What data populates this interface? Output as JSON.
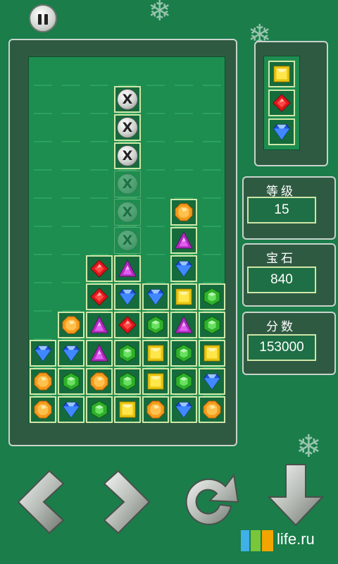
{
  "stats": {
    "level": {
      "label": "等级",
      "value": "15"
    },
    "gems": {
      "label": "宝石",
      "value": "840"
    },
    "score": {
      "label": "分数",
      "value": "153000"
    }
  },
  "watermark": {
    "text": "life.ru"
  },
  "icons": {
    "pause": "pause-icon",
    "left": "arrow-left-icon",
    "right": "arrow-right-icon",
    "rotate": "rotate-icon",
    "drop": "arrow-down-icon",
    "snowflake": "snowflake-icon"
  },
  "colors": {
    "background": "#1a7d4a",
    "board": "#1e8d50",
    "frame": "#2f5a42",
    "cell_border": "#cfe7a8"
  },
  "board": {
    "columns": 7,
    "rows": 13,
    "falling_piece": [
      "x",
      "x",
      "x"
    ],
    "cells": [
      {
        "r": 5,
        "c": 5,
        "g": "orange"
      },
      {
        "r": 6,
        "c": 5,
        "g": "purple"
      },
      {
        "r": 7,
        "c": 2,
        "g": "red"
      },
      {
        "r": 7,
        "c": 3,
        "g": "purple"
      },
      {
        "r": 7,
        "c": 5,
        "g": "blue"
      },
      {
        "r": 8,
        "c": 2,
        "g": "red"
      },
      {
        "r": 8,
        "c": 3,
        "g": "blue"
      },
      {
        "r": 8,
        "c": 4,
        "g": "blue"
      },
      {
        "r": 8,
        "c": 5,
        "g": "yellow"
      },
      {
        "r": 8,
        "c": 6,
        "g": "green"
      },
      {
        "r": 9,
        "c": 1,
        "g": "orange"
      },
      {
        "r": 9,
        "c": 2,
        "g": "purple"
      },
      {
        "r": 9,
        "c": 3,
        "g": "red"
      },
      {
        "r": 9,
        "c": 4,
        "g": "green"
      },
      {
        "r": 9,
        "c": 5,
        "g": "purple"
      },
      {
        "r": 9,
        "c": 6,
        "g": "green"
      },
      {
        "r": 10,
        "c": 0,
        "g": "blue"
      },
      {
        "r": 10,
        "c": 1,
        "g": "blue"
      },
      {
        "r": 10,
        "c": 2,
        "g": "purple"
      },
      {
        "r": 10,
        "c": 3,
        "g": "green"
      },
      {
        "r": 10,
        "c": 4,
        "g": "yellow"
      },
      {
        "r": 10,
        "c": 5,
        "g": "green"
      },
      {
        "r": 10,
        "c": 6,
        "g": "yellow"
      },
      {
        "r": 11,
        "c": 0,
        "g": "orange"
      },
      {
        "r": 11,
        "c": 1,
        "g": "green"
      },
      {
        "r": 11,
        "c": 2,
        "g": "orange"
      },
      {
        "r": 11,
        "c": 3,
        "g": "green"
      },
      {
        "r": 11,
        "c": 4,
        "g": "yellow"
      },
      {
        "r": 11,
        "c": 5,
        "g": "green"
      },
      {
        "r": 11,
        "c": 6,
        "g": "blue"
      },
      {
        "r": 12,
        "c": 0,
        "g": "orange"
      },
      {
        "r": 12,
        "c": 1,
        "g": "blue"
      },
      {
        "r": 12,
        "c": 2,
        "g": "green"
      },
      {
        "r": 12,
        "c": 3,
        "g": "yellow"
      },
      {
        "r": 12,
        "c": 4,
        "g": "orange"
      },
      {
        "r": 12,
        "c": 5,
        "g": "blue"
      },
      {
        "r": 12,
        "c": 6,
        "g": "orange"
      }
    ],
    "falling_col": 3,
    "falling_rows": [
      1,
      2,
      3
    ],
    "ghost_rows": [
      4,
      5,
      6
    ]
  },
  "next_piece": [
    "yellow",
    "red",
    "blue"
  ]
}
